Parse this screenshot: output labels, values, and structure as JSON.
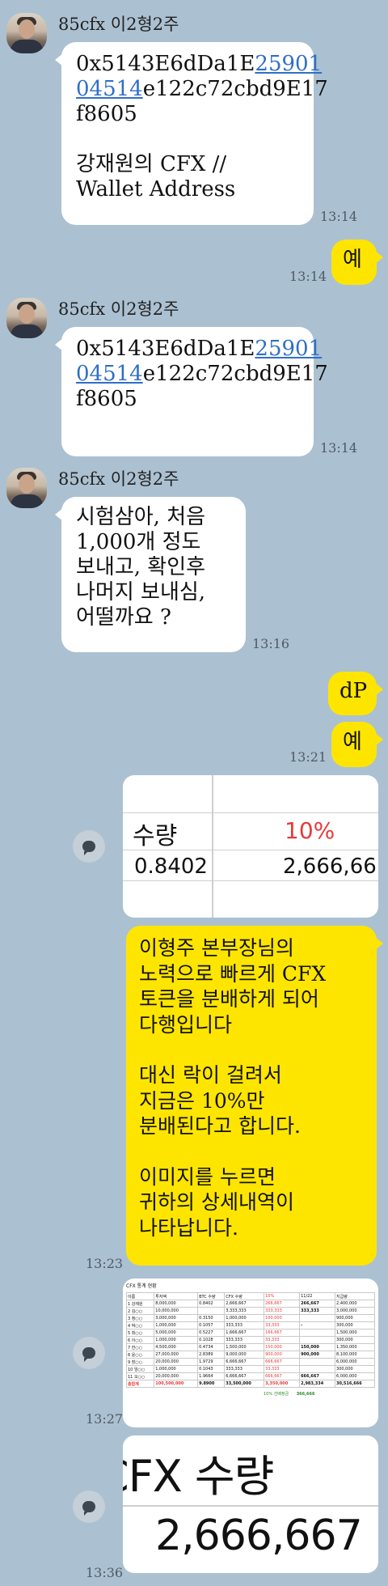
{
  "messages": {
    "m1": {
      "sender": "85cfx 이2형2주",
      "line1_pre": "0x5143E6dDa1E",
      "line1_link": "25901",
      "line2_link": "04514",
      "line2_post": "e122c72cbd9E17",
      "line3": "f8605",
      "line4": "강재원의 CFX //",
      "line5": "Wallet Address",
      "time": "13:14"
    },
    "m2": {
      "text": "예",
      "time": "13:14"
    },
    "m3": {
      "sender": "85cfx 이2형2주",
      "line1_pre": "0x5143E6dDa1E",
      "line1_link": "25901",
      "line2_link": "04514",
      "line2_post": "e122c72cbd9E17",
      "line3": "f8605",
      "time": "13:14"
    },
    "m4": {
      "sender": "85cfx 이2형2주",
      "lines": [
        "시험삼아, 처음",
        "1,000개 정도",
        "보내고, 확인후",
        "나머지 보내심,",
        "어떨까요 ?"
      ],
      "time": "13:16"
    },
    "m5": {
      "text": "dP"
    },
    "m6": {
      "text": "예",
      "time": "13:21"
    },
    "m7": {
      "col_label": "수량",
      "pct_label": "10%",
      "v1": "0.8402",
      "v2": "2,666,66"
    },
    "m8": {
      "lines": [
        "이형주 본부장님의",
        "노력으로 빠르게 CFX",
        "토큰을 분배하게 되어",
        "다행입니다",
        "",
        "대신 락이 걸려서",
        "지금은 10%만",
        "분배된다고 합니다.",
        "",
        "이미지를 누르면",
        "귀하의 상세내역이",
        "나타납니다."
      ],
      "time": "13:23"
    },
    "m9": {
      "title": "CFX 통계 현황",
      "header": [
        "이름",
        "투자액",
        "BTC 수량",
        "CFX 수량",
        "10%",
        "11/22",
        "지급량"
      ],
      "rows": [
        [
          "1 강재원",
          "8,000,000",
          "0.8402",
          "2,666,667",
          "266,667",
          "266,667",
          "2,400,000"
        ],
        [
          "2 김○○",
          "10,000,000",
          "",
          "3,333,333",
          "333,333",
          "333,333",
          "3,000,000"
        ],
        [
          "3 정○○",
          "3,000,000",
          "0.3150",
          "1,000,000",
          "100,000",
          "",
          "900,000"
        ],
        [
          "4 박○○",
          "1,000,000",
          "0.1057",
          "333,333",
          "33,333",
          "-",
          "300,000"
        ],
        [
          "5 최○○",
          "5,000,000",
          "0.5227",
          "1,666,667",
          "166,667",
          "",
          "1,500,000"
        ],
        [
          "6 이○○",
          "1,000,000",
          "0.1028",
          "333,333",
          "33,333",
          "",
          "300,000"
        ],
        [
          "7 한○○",
          "4,500,000",
          "0.4734",
          "1,500,000",
          "150,000",
          "150,000",
          "1,350,000"
        ],
        [
          "8 윤○○",
          "27,000,000",
          "2.8389",
          "9,000,000",
          "900,000",
          "900,000",
          "8,100,000"
        ],
        [
          "9 장○○",
          "20,000,000",
          "1.9729",
          "6,666,667",
          "666,667",
          "",
          "6,000,000"
        ],
        [
          "10 임○○",
          "1,000,000",
          "0.1043",
          "333,333",
          "33,333",
          "",
          "300,000"
        ],
        [
          "11 오○○",
          "20,000,000",
          "1.9664",
          "6,666,667",
          "666,667",
          "666,667",
          "6,000,000"
        ]
      ],
      "total": [
        "총합계",
        "100,500,000",
        "9.8900",
        "33,500,000",
        "3,350,000",
        "2,983,334",
        "30,516,666"
      ],
      "footer_label": "10% 선배정금",
      "footer_value": "366,666",
      "time": "13:27"
    },
    "m10": {
      "line1": "CFX 수량",
      "line2": "2,666,667",
      "time": "13:36"
    }
  },
  "colors": {
    "background": "#abc1d1",
    "outgoing": "#fee500",
    "incoming": "#ffffff",
    "link": "#2f6fc8",
    "red": "#e63a3a"
  }
}
